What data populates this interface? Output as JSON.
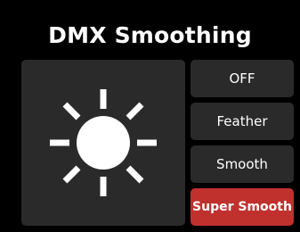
{
  "header": {
    "title": "DMX Smoothing"
  },
  "preview": {
    "icon": "sun-icon",
    "color": "#ffffff"
  },
  "modes": [
    {
      "label": "OFF",
      "selected": false
    },
    {
      "label": "Feather",
      "selected": false
    },
    {
      "label": "Smooth",
      "selected": false
    },
    {
      "label": "Super Smooth",
      "selected": true
    }
  ],
  "colors": {
    "background": "#000000",
    "panel": "#2a2a2a",
    "active": "#c0312e",
    "text": "#ffffff"
  }
}
